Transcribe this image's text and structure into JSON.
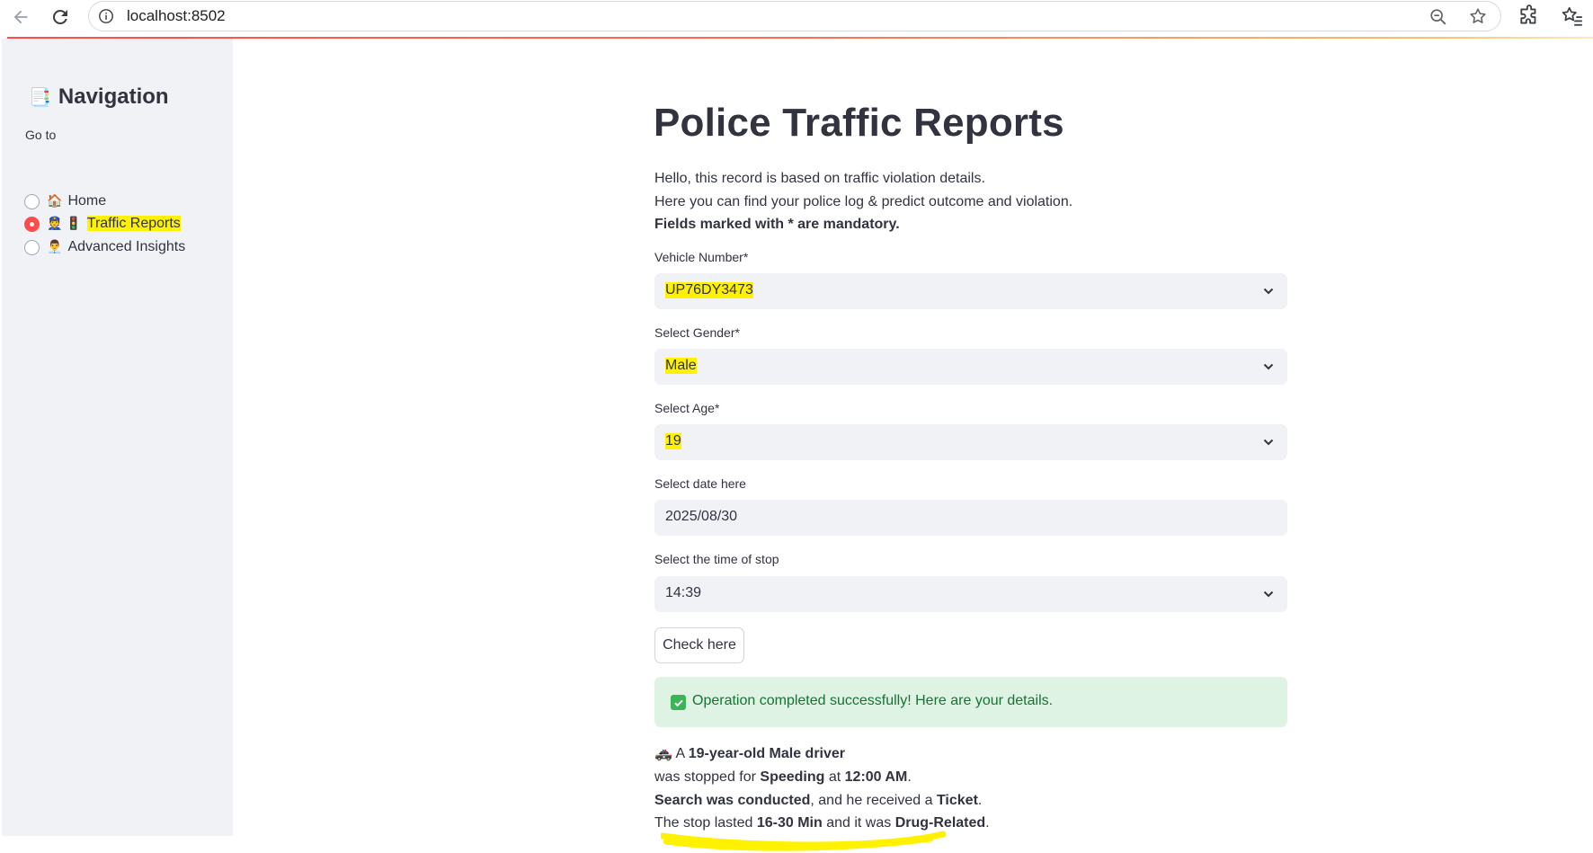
{
  "browser": {
    "url": "localhost:8502"
  },
  "sidebar": {
    "nav_emoji": "📑",
    "title": "Navigation",
    "goto_label": "Go to",
    "items": [
      {
        "emoji": "🏠",
        "label": "Home",
        "selected": false
      },
      {
        "emoji": "👮 🚦",
        "label": "Traffic Reports",
        "selected": true
      },
      {
        "emoji": "👨‍💼",
        "label": "Advanced Insights",
        "selected": false
      }
    ]
  },
  "main": {
    "title": "Police Traffic Reports",
    "intro_line1": "Hello, this record is based on traffic violation details.",
    "intro_line2": "Here you can find your police log & predict outcome and violation.",
    "intro_line3": "Fields marked with * are mandatory.",
    "fields": {
      "vehicle": {
        "label": "Vehicle Number*",
        "value": "UP76DY3473"
      },
      "gender": {
        "label": "Select Gender*",
        "value": "Male"
      },
      "age": {
        "label": "Select Age*",
        "value": "19"
      },
      "date": {
        "label": "Select date here",
        "value": "2025/08/30"
      },
      "time": {
        "label": "Select the time of stop",
        "value": "14:39"
      }
    },
    "check_button": "Check here",
    "success_message": "Operation completed successfully! Here are your details.",
    "summary": {
      "emoji": "🚓",
      "p1_a": "A ",
      "p1_b": "19-year-old Male driver",
      "p2_a": "was stopped for ",
      "p2_b": "Speeding",
      "p2_c": " at ",
      "p2_d": "12:00 AM",
      "p2_e": ".",
      "p3_a": "Search was conducted",
      "p3_b": ", and he received a ",
      "p3_c": "Ticket",
      "p3_d": ".",
      "p4_a": "The stop lasted ",
      "p4_b": "16-30 Min",
      "p4_c": " and it was ",
      "p4_d": "Drug-Related",
      "p4_e": "."
    }
  },
  "colors": {
    "accent": "#ff4b4b",
    "sidebar_bg": "#f0f2f6",
    "success_bg": "#dff3e4",
    "success_text": "#177233",
    "highlight": "#fff200"
  }
}
